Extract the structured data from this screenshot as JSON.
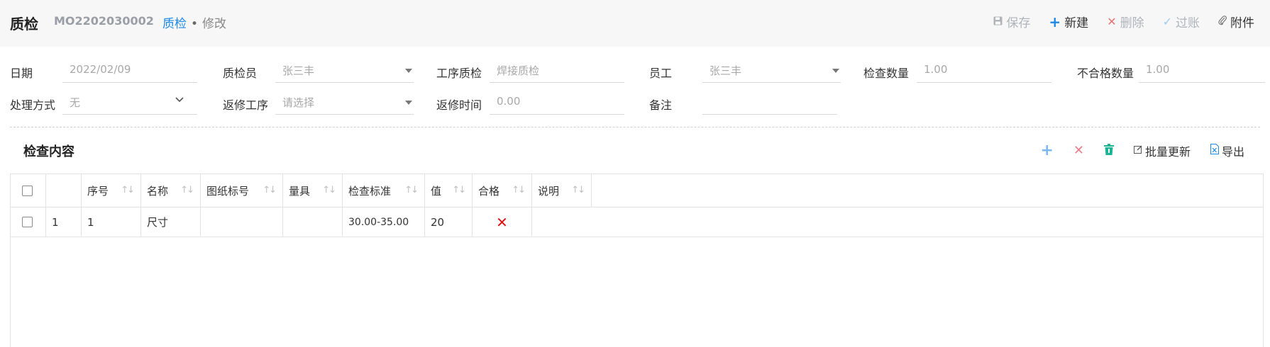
{
  "header": {
    "title": "质检",
    "doc_no": "MO2202030002",
    "breadcrumb": {
      "current": "质检",
      "separator": "•",
      "mode": "修改"
    },
    "toolbar": {
      "save": "保存",
      "new": "新建",
      "delete": "删除",
      "post": "过账",
      "attach": "附件"
    }
  },
  "form": {
    "date": {
      "label": "日期",
      "value": "2022/02/09"
    },
    "inspector": {
      "label": "质检员",
      "value": "张三丰"
    },
    "process_qc": {
      "label": "工序质检",
      "value": "焊接质检"
    },
    "employee": {
      "label": "员工",
      "value": "张三丰"
    },
    "inspect_qty": {
      "label": "检查数量",
      "value": "1.00"
    },
    "fail_qty": {
      "label": "不合格数量",
      "value": "1.00"
    },
    "handling": {
      "label": "处理方式",
      "value": "无"
    },
    "rework_process": {
      "label": "返修工序",
      "placeholder": "请选择"
    },
    "rework_time": {
      "label": "返修时间",
      "value": "0.00"
    },
    "remark": {
      "label": "备注",
      "value": ""
    }
  },
  "section": {
    "title": "检查内容",
    "tools": {
      "batch_update": "批量更新",
      "export": "导出"
    }
  },
  "table": {
    "columns": [
      "序号",
      "名称",
      "图纸标号",
      "量具",
      "检查标准",
      "值",
      "合格",
      "说明"
    ],
    "rows": [
      {
        "row_no": "1",
        "seq": "1",
        "name": "尺寸",
        "drawing_no": "",
        "gauge": "",
        "standard": "30.00-35.00",
        "value": "20",
        "pass": false,
        "note": ""
      }
    ]
  },
  "colors": {
    "accent": "#1e88e5",
    "fail": "#dd1111",
    "trash": "#1ab394"
  }
}
